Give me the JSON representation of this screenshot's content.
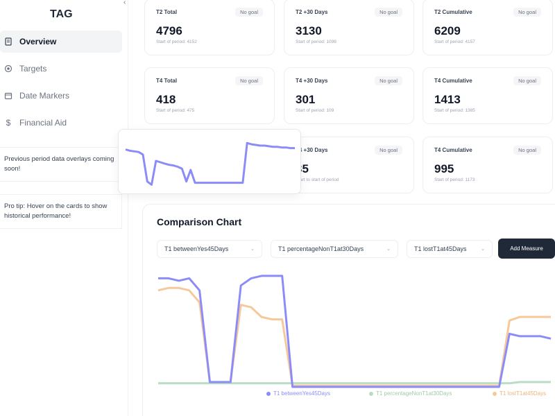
{
  "sidebar": {
    "brand": "TAG",
    "items": [
      {
        "label": "Overview",
        "icon": "document-icon"
      },
      {
        "label": "Targets",
        "icon": "target-icon"
      },
      {
        "label": "Date Markers",
        "icon": "calendar-icon"
      },
      {
        "label": "Financial Aid",
        "icon": "dollar-icon"
      }
    ],
    "notes": [
      "Previous period data overlays coming soon!",
      "Pro tip: Hover on the cards to show historical performance!"
    ]
  },
  "cards": [
    {
      "title": "T2 Total",
      "badge": "No goal",
      "value": "4796",
      "sub": "Start of period: 4152"
    },
    {
      "title": "T2 +30 Days",
      "badge": "No goal",
      "value": "3130",
      "sub": "Start of period: 1098"
    },
    {
      "title": "T2 Cumulative",
      "badge": "No goal",
      "value": "6209",
      "sub": "Start of period: 4157"
    },
    {
      "title": "T4 Total",
      "badge": "No goal",
      "value": "418",
      "sub": "Start of period: 475"
    },
    {
      "title": "T4 +30 Days",
      "badge": "No goal",
      "value": "301",
      "sub": "Start of period: 109"
    },
    {
      "title": "T4 Cumulative",
      "badge": "No goal",
      "value": "1413",
      "sub": "Start of period: 1385"
    },
    {
      "title": "T4 +30 Days",
      "badge": "No goal",
      "value": "35",
      "sub": "Start to start of period"
    },
    {
      "title": "T4 Cumulative",
      "badge": "No goal",
      "value": "995",
      "sub": "Start of period: 1173"
    }
  ],
  "chart": {
    "title": "Comparison Chart",
    "selectors": [
      "T1 betweenYes45Days",
      "T1 percentageNonT1at30Days",
      "T1 lostT1at45Days"
    ],
    "add_label": "Add Measure",
    "legend": [
      "T1 betweenYes45Days",
      "T1 percentageNonT1at30Days",
      "T1 lostT1at45Days"
    ],
    "colors": {
      "blue": "#8b8cf8",
      "orange": "#f6c89a",
      "green": "#b9dcc4"
    }
  },
  "chart_data": {
    "type": "line",
    "series": [
      {
        "name": "T1 betweenYes45Days",
        "values": [
          90,
          90,
          88,
          90,
          80,
          4,
          4,
          4,
          84,
          90,
          92,
          92,
          92,
          0,
          0,
          0,
          0,
          0,
          0,
          0,
          0,
          0,
          0,
          0,
          0,
          0,
          0,
          0,
          0,
          0,
          0,
          0,
          0,
          0,
          44,
          42,
          42,
          42,
          40
        ]
      },
      {
        "name": "T1 percentageNonT1at30Days",
        "values": [
          80,
          82,
          82,
          80,
          70,
          4,
          4,
          4,
          68,
          66,
          58,
          56,
          56,
          1,
          1,
          1,
          1,
          1,
          1,
          1,
          1,
          1,
          1,
          1,
          1,
          1,
          1,
          1,
          1,
          1,
          1,
          1,
          1,
          1,
          55,
          58,
          58,
          58,
          58
        ]
      },
      {
        "name": "T1 lostT1at45Days",
        "values": [
          3,
          3,
          3,
          3,
          3,
          3,
          3,
          3,
          3,
          3,
          3,
          3,
          3,
          3,
          3,
          3,
          3,
          3,
          3,
          3,
          3,
          3,
          3,
          3,
          3,
          3,
          3,
          3,
          3,
          3,
          3,
          3,
          3,
          3,
          3,
          4,
          4,
          4,
          4
        ]
      }
    ],
    "ylim": [
      0,
      100
    ]
  },
  "sparkline": {
    "values": [
      60,
      58,
      57,
      56,
      52,
      10,
      5,
      42,
      40,
      38,
      36,
      35,
      33,
      30,
      10,
      28,
      8,
      8,
      8,
      8,
      8,
      8,
      8,
      8,
      8,
      8,
      8,
      8,
      70,
      68,
      67,
      66,
      66,
      65,
      64,
      64,
      63,
      63,
      62,
      62
    ],
    "color": "#8b8cf8"
  }
}
